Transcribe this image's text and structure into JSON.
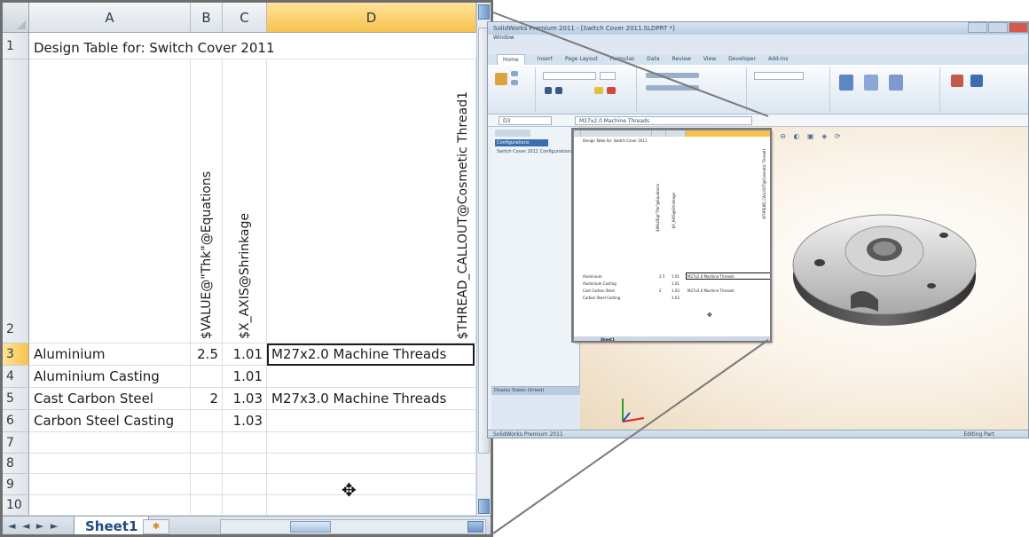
{
  "zoom": {
    "columns": [
      "A",
      "B",
      "C",
      "D"
    ],
    "rows": [
      "1",
      "2",
      "3",
      "4",
      "5",
      "6",
      "7",
      "8",
      "9",
      "10"
    ],
    "title": "Design Table for: Switch Cover 2011",
    "headers": {
      "b": "$VALUE@\"Thk\"@Equations",
      "c": "$X_AXIS@Shrinkage",
      "d": "$THREAD_CALLOUT@Cosmetic Thread1"
    },
    "data": [
      {
        "a": "Aluminium",
        "b": "2.5",
        "c": "1.01",
        "d": "M27x2.0 Machine Threads"
      },
      {
        "a": "Aluminium Casting",
        "b": "",
        "c": "1.01",
        "d": ""
      },
      {
        "a": "Cast Carbon Steel",
        "b": "2",
        "c": "1.03",
        "d": "M27x3.0 Machine Threads"
      },
      {
        "a": "Carbon Steel Casting",
        "b": "",
        "c": "1.03",
        "d": ""
      }
    ],
    "sheet_tab": "Sheet1",
    "tab_nav": "◄ ◄ ► ►",
    "move_cursor": "✥"
  },
  "app": {
    "window_title": "SolidWorks Premium 2011 - [Switch Cover 2011.SLDPRT *]",
    "menu": "Window",
    "ribbon_tabs": [
      "Home",
      "Insert",
      "Page Layout",
      "Formulas",
      "Data",
      "Review",
      "View",
      "Developer",
      "Add-Ins"
    ],
    "name_box": "D3",
    "formula": "M27x2.0 Machine Threads",
    "tree_item": "Configurations",
    "tree_sel": "Switch Cover 2011 Configurations",
    "display_states": "Display States (linked)",
    "status_left": "SolidWorks Premium 2011",
    "status_right": "Editing Part"
  },
  "colors": {
    "selected_header": "#f7c24c",
    "ribbon_blue": "#dbe6f2",
    "viewport_bg": "#fbf4ea"
  }
}
